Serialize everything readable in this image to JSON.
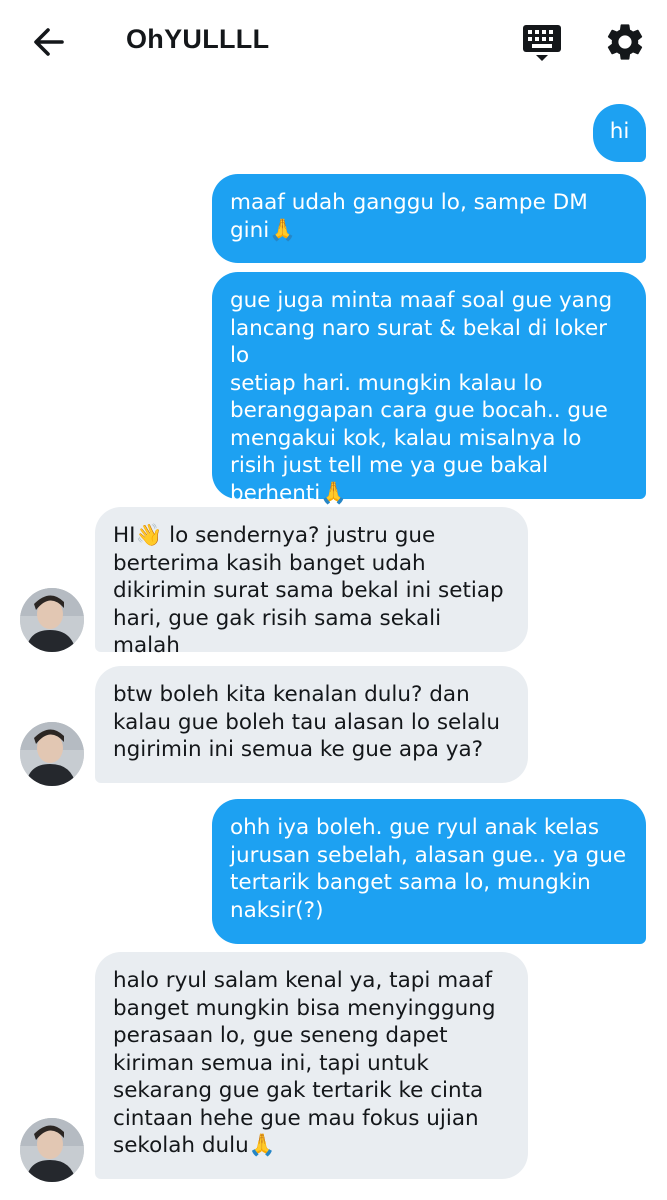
{
  "header": {
    "title": "OhYULLLL",
    "icons": {
      "back": "arrow-left-icon",
      "keyboard": "keyboard-icon",
      "settings": "gear-icon"
    }
  },
  "colors": {
    "outgoing_bubble": "#1da1f2",
    "incoming_bubble": "#e9edf1"
  },
  "messages": [
    {
      "direction": "out",
      "text": "hi"
    },
    {
      "direction": "out",
      "text": "maaf udah ganggu lo, sampe DM\ngini🙏"
    },
    {
      "direction": "out",
      "text": "gue juga minta maaf soal gue yang\nlancang naro surat & bekal di loker lo\nsetiap hari. mungkin kalau lo\nberanggapan cara gue bocah.. gue\nmengakui kok, kalau misalnya lo\nrisih just tell me ya gue bakal\nberhenti🙏"
    },
    {
      "direction": "in",
      "text": "HI👋 lo sendernya? justru gue\nberterima kasih banget udah\ndikirimin surat sama bekal ini setiap\nhari, gue gak risih sama sekali malah"
    },
    {
      "direction": "in",
      "text": "btw boleh kita kenalan dulu? dan\nkalau gue boleh tau alasan lo selalu\nngirimin ini semua ke gue apa ya?"
    },
    {
      "direction": "out",
      "text": "ohh iya boleh. gue ryul anak kelas\njurusan sebelah, alasan gue.. ya gue\ntertarik banget sama lo, mungkin\nnaksir(?)"
    },
    {
      "direction": "in",
      "text": "halo ryul salam kenal ya, tapi maaf\nbanget mungkin bisa menyinggung\nperasaan lo, gue seneng dapet\nkiriman semua ini, tapi untuk\nsekarang gue gak tertarik ke cinta\ncintaan hehe gue mau fokus ujian\nsekolah dulu🙏"
    }
  ]
}
